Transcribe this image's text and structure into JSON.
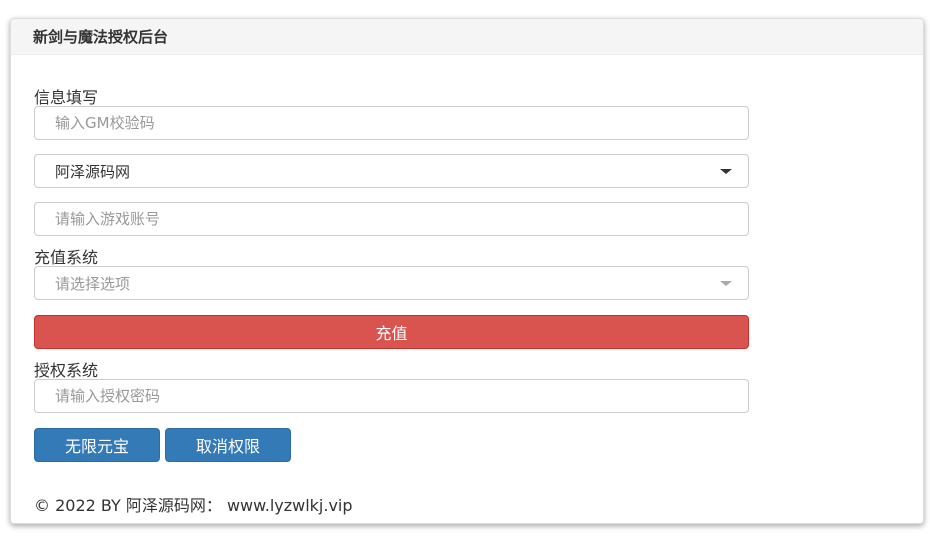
{
  "panel": {
    "title": "新剑与魔法授权后台"
  },
  "info_section": {
    "label": "信息填写",
    "gm_code_placeholder": "输入GM校验码",
    "server_select_value": "阿泽源码网",
    "account_placeholder": "请输入游戏账号"
  },
  "recharge_section": {
    "label": "充值系统",
    "option_placeholder": "请选择选项",
    "recharge_button": "充值"
  },
  "auth_section": {
    "label": "授权系统",
    "password_placeholder": "请输入授权密码",
    "unlimited_button": "无限元宝",
    "revoke_button": "取消权限"
  },
  "footer": {
    "text": "© 2022 BY 阿泽源码网： www.lyzwlkj.vip"
  },
  "colors": {
    "danger": "#d9534f",
    "primary": "#337ab7",
    "heading_bg": "#f5f5f5"
  },
  "icons": {
    "select_caret": "chevron-down-icon"
  }
}
